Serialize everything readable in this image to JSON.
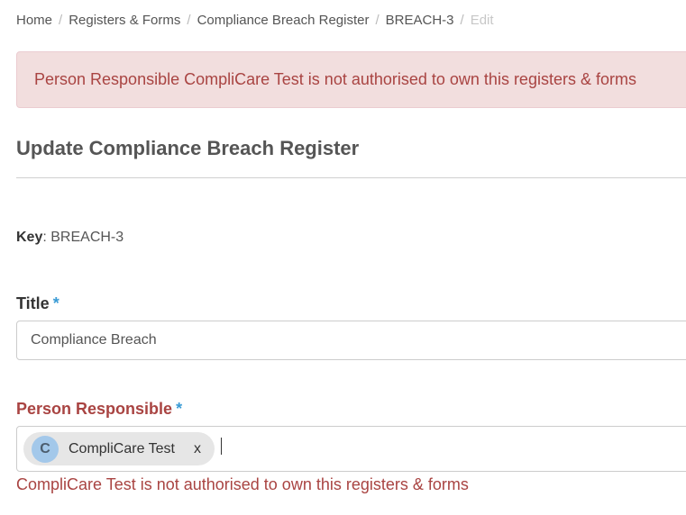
{
  "breadcrumb": {
    "items": [
      "Home",
      "Registers & Forms",
      "Compliance Breach Register",
      "BREACH-3"
    ],
    "active": "Edit",
    "separator": "/"
  },
  "alert": {
    "message": "Person Responsible CompliCare Test is not authorised to own this registers & forms"
  },
  "page_title": "Update Compliance Breach Register",
  "key": {
    "label": "Key",
    "value": ": BREACH-3"
  },
  "fields": {
    "title": {
      "label": "Title",
      "required_marker": "*",
      "value": "Compliance Breach"
    },
    "person_responsible": {
      "label": "Person Responsible",
      "required_marker": "*",
      "chip": {
        "avatar_initial": "C",
        "name": "CompliCare Test",
        "remove_label": "x"
      },
      "error": "CompliCare Test is not authorised to own this registers & forms"
    }
  },
  "colors": {
    "error": "#a94442",
    "alert_background": "#f2dede",
    "required_marker": "#3a9bd5",
    "avatar": "#a3c8ea"
  }
}
